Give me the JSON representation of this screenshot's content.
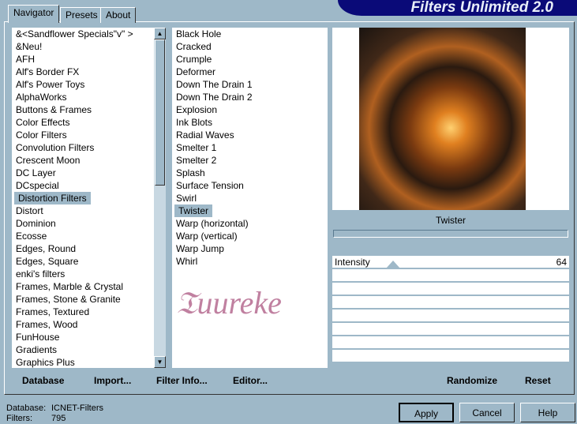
{
  "title": "Filters Unlimited 2.0",
  "tabs": [
    {
      "label": "Navigator"
    },
    {
      "label": "Presets"
    },
    {
      "label": "About"
    }
  ],
  "categories": [
    "&<Sandflower Specials\"v\" >",
    "&Neu!",
    "AFH",
    "Alf's Border FX",
    "Alf's Power Toys",
    "AlphaWorks",
    "Buttons & Frames",
    "Color Effects",
    "Color Filters",
    "Convolution Filters",
    "Crescent Moon",
    "DC Layer",
    "DCspecial",
    "Distortion Filters",
    "Distort",
    "Dominion",
    "Ecosse",
    "Edges, Round",
    "Edges, Square",
    "enki's filters",
    "Frames, Marble & Crystal",
    "Frames, Stone & Granite",
    "Frames, Textured",
    "Frames, Wood",
    "FunHouse",
    "Gradients",
    "Graphics Plus"
  ],
  "selected_category": "Distortion Filters",
  "filters": [
    "Black Hole",
    "Cracked",
    "Crumple",
    "Deformer",
    "Down The Drain 1",
    "Down The Drain 2",
    "Explosion",
    "Ink Blots",
    "Radial Waves",
    "Smelter 1",
    "Smelter 2",
    "Splash",
    "Surface Tension",
    "Swirl",
    "Twister",
    "Warp (horizontal)",
    "Warp (vertical)",
    "Warp Jump",
    "Whirl"
  ],
  "selected_filter": "Twister",
  "watermark": "Tuureke",
  "preview_label": "Twister",
  "sliders": [
    {
      "label": "Intensity",
      "value": "64",
      "fraction": 0.25
    }
  ],
  "buttons": {
    "database": "Database",
    "import": "Import...",
    "filter_info": "Filter Info...",
    "editor": "Editor...",
    "randomize": "Randomize",
    "reset": "Reset",
    "apply": "Apply",
    "cancel": "Cancel",
    "help": "Help"
  },
  "status": {
    "database_label": "Database:",
    "database_value": "ICNET-Filters",
    "filters_label": "Filters:",
    "filters_value": "795"
  }
}
